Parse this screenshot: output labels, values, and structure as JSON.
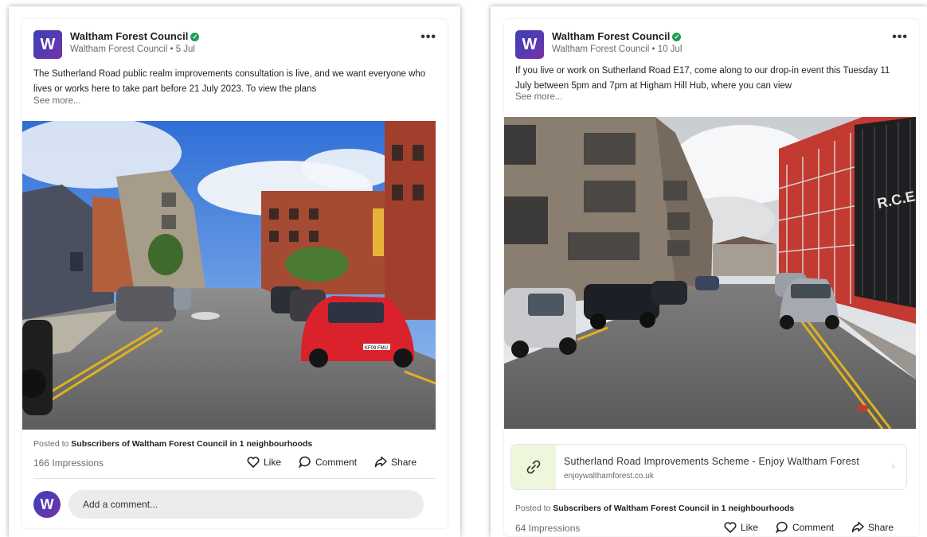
{
  "posts": [
    {
      "avatar_letter": "W",
      "org_name": "Waltham Forest Council",
      "sub_line": "Waltham Forest Council • 5 Jul",
      "text": "The Sutherland Road public realm improvements consultation is live, and we want everyone who lives or works here to take part before 21 July 2023. To view the plans",
      "see_more": "See more...",
      "posted_prefix": "Posted to",
      "posted_target": "Subscribers of Waltham Forest Council in 1 neighbourhoods",
      "impressions": "166 Impressions",
      "like": "Like",
      "comment": "Comment",
      "share": "Share",
      "comment_placeholder": "Add a comment..."
    },
    {
      "avatar_letter": "W",
      "org_name": "Waltham Forest Council",
      "sub_line": "Waltham Forest Council • 10 Jul",
      "text": "If you live or work on Sutherland Road E17, come along to our drop-in event  this Tuesday 11 July between 5pm and 7pm at Higham Hill Hub, where you can view",
      "see_more": "See more...",
      "link_title": "Sutherland Road Improvements Scheme - Enjoy Waltham Forest",
      "link_domain": "enjoywalthamforest.co.uk",
      "posted_prefix": "Posted to",
      "posted_target": "Subscribers of Waltham Forest Council in 1 neighbourhoods",
      "impressions": "64 Impressions",
      "like": "Like",
      "comment": "Comment",
      "share": "Share"
    }
  ],
  "images": [
    {
      "description_icon": "street-photo-icon",
      "plate": "KF09 FMU"
    },
    {
      "description_icon": "street-photo-icon",
      "signage": "R.C.E. MICS"
    }
  ],
  "colors": {
    "verified": "#1f9d55",
    "avatar": "#4b3cb3",
    "link_icon_bg": "#eef6dc"
  }
}
